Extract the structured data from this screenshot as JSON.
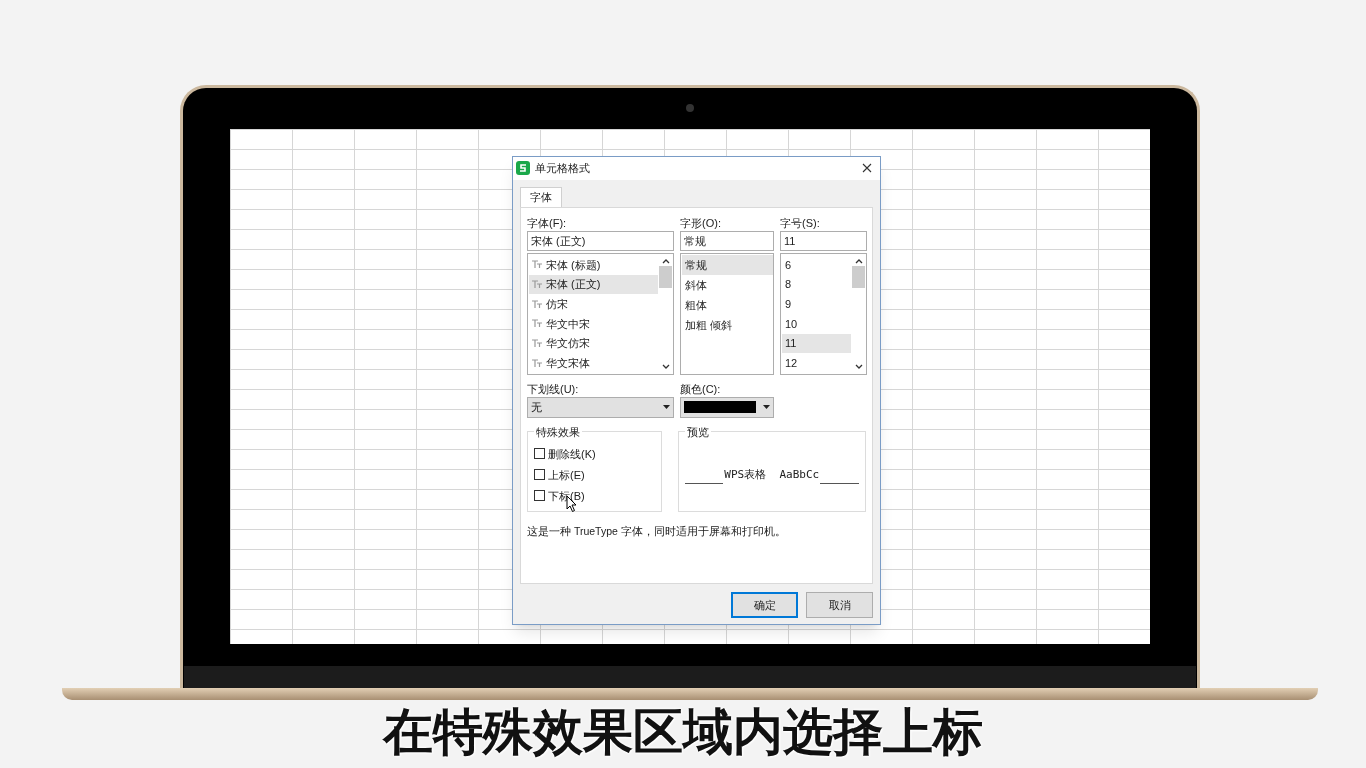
{
  "dialog": {
    "title": "单元格格式",
    "tabs": [
      {
        "label": "字体",
        "selected": true
      }
    ],
    "font": {
      "label": "字体(F):",
      "value": "宋体 (正文)",
      "items": [
        {
          "label": "宋体 (标题)",
          "selected": false
        },
        {
          "label": "宋体 (正文)",
          "selected": true
        },
        {
          "label": "仿宋",
          "selected": false
        },
        {
          "label": "华文中宋",
          "selected": false
        },
        {
          "label": "华文仿宋",
          "selected": false
        },
        {
          "label": "华文宋体",
          "selected": false
        }
      ]
    },
    "style": {
      "label": "字形(O):",
      "value": "常规",
      "items": [
        {
          "label": "常规",
          "selected": true
        },
        {
          "label": "斜体",
          "selected": false
        },
        {
          "label": "粗体",
          "selected": false
        },
        {
          "label": "加粗 倾斜",
          "selected": false
        }
      ]
    },
    "size": {
      "label": "字号(S):",
      "value": "11",
      "items": [
        {
          "label": "6",
          "selected": false
        },
        {
          "label": "8",
          "selected": false
        },
        {
          "label": "9",
          "selected": false
        },
        {
          "label": "10",
          "selected": false
        },
        {
          "label": "11",
          "selected": true
        },
        {
          "label": "12",
          "selected": false
        }
      ]
    },
    "underline": {
      "label": "下划线(U):",
      "value": "无"
    },
    "color": {
      "label": "颜色(C):"
    },
    "effects": {
      "legend": "特殊效果",
      "options": [
        {
          "label": "删除线(K)",
          "checked": false
        },
        {
          "label": "上标(E)",
          "checked": false
        },
        {
          "label": "下标(B)",
          "checked": false
        }
      ]
    },
    "preview": {
      "legend": "预览",
      "sample": "WPS表格  AaBbCc"
    },
    "note": "这是一种 TrueType 字体，同时适用于屏幕和打印机。",
    "buttons": [
      {
        "label": "确定",
        "default": true
      },
      {
        "label": "取消",
        "default": false
      }
    ]
  },
  "caption": "在特殊效果区域内选择上标"
}
